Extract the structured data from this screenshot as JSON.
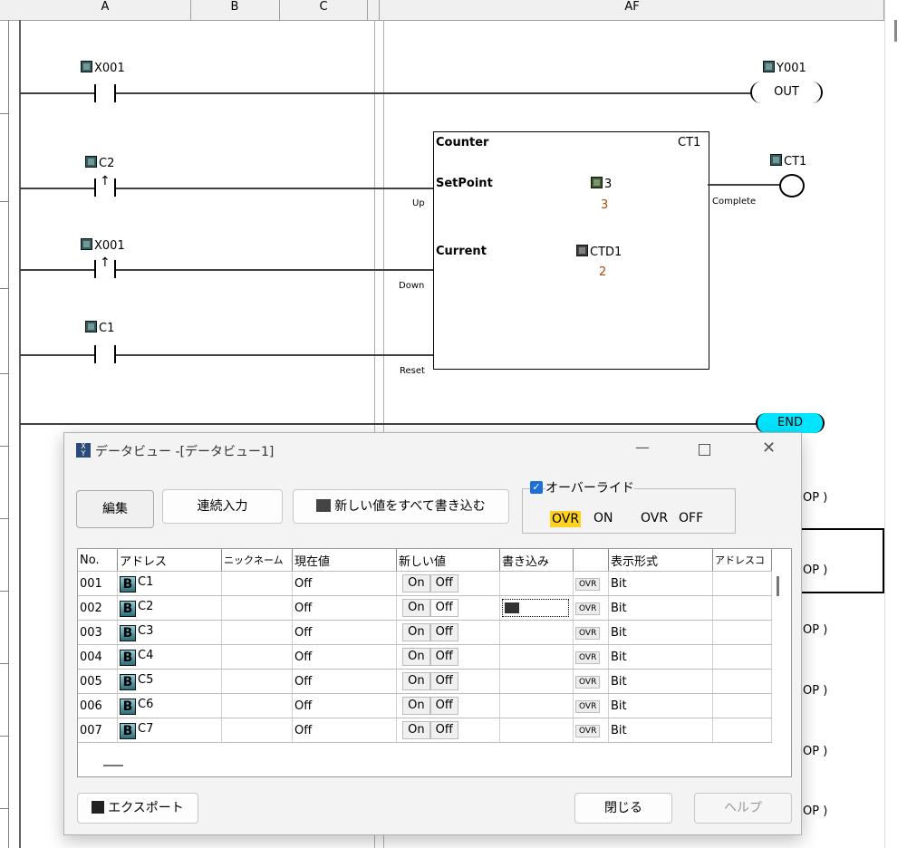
{
  "columns": [
    "A",
    "B",
    "C",
    "AF"
  ],
  "ladder": {
    "rung1": {
      "contact": "X001",
      "coil": "Y001",
      "coil_label": "OUT"
    },
    "rung2": {
      "contact": "C2",
      "block_title": "Counter",
      "block_id": "CT1",
      "setpoint_label": "SetPoint",
      "setpoint_addr": "3",
      "setpoint_val": "3",
      "current_label": "Current",
      "current_addr": "CTD1",
      "current_val": "2",
      "up": "Up",
      "complete": "Complete",
      "out": "CT1"
    },
    "rung3": {
      "contact": "X001",
      "down": "Down"
    },
    "rung4": {
      "contact": "C1",
      "reset": "Reset"
    },
    "end": "END",
    "nop": "OP )"
  },
  "dialog": {
    "title": "データビュー -[データビュー1]",
    "edit": "編集",
    "continuous": "連続入力",
    "write_all": "新しい値をすべて書き込む",
    "override": "オーバーライド",
    "ovr": "OVR",
    "on": "ON",
    "off": "OFF",
    "export": "エクスポート",
    "close": "閉じる",
    "help": "ヘルプ",
    "headers": [
      "No.",
      "アドレス",
      "ニックネーム",
      "現在値",
      "新しい値",
      "書き込み",
      "",
      "表示形式",
      "アドレスコ"
    ],
    "rows": [
      {
        "no": "001",
        "addr": "C1",
        "cur": "Off",
        "fmt": "Bit"
      },
      {
        "no": "002",
        "addr": "C2",
        "cur": "Off",
        "fmt": "Bit"
      },
      {
        "no": "003",
        "addr": "C3",
        "cur": "Off",
        "fmt": "Bit"
      },
      {
        "no": "004",
        "addr": "C4",
        "cur": "Off",
        "fmt": "Bit"
      },
      {
        "no": "005",
        "addr": "C5",
        "cur": "Off",
        "fmt": "Bit"
      },
      {
        "no": "006",
        "addr": "C6",
        "cur": "Off",
        "fmt": "Bit"
      },
      {
        "no": "007",
        "addr": "C7",
        "cur": "Off",
        "fmt": "Bit"
      }
    ],
    "on_btn": "On",
    "off_btn": "Off",
    "ovr_small": "OVR"
  }
}
